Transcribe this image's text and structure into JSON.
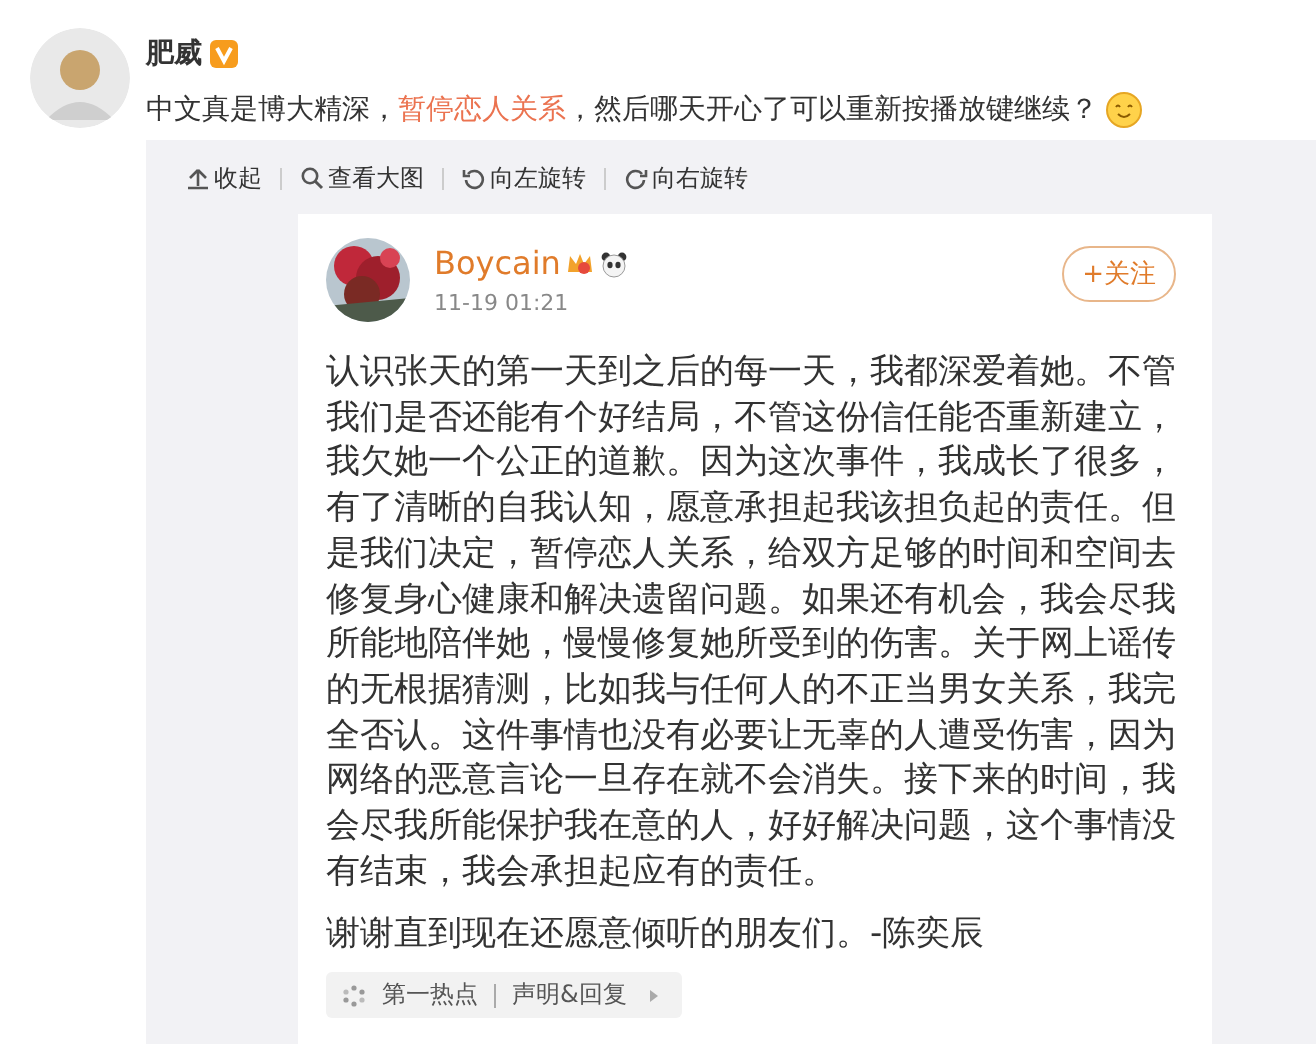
{
  "post": {
    "author": "肥威",
    "verified": true,
    "text_parts": [
      {
        "text": "中文真是博大精深，",
        "highlight": false
      },
      {
        "text": "暂停恋人关系",
        "highlight": true
      },
      {
        "text": "，然后哪天开心了可以重新按播放键继续？",
        "highlight": false
      }
    ]
  },
  "toolbar": [
    "收起",
    "查看大图",
    "向左旋转",
    "向右旋转"
  ],
  "screenshot": {
    "author": "Boycain",
    "time": "11-19 01:21",
    "follow_button": "+关注",
    "body": "认识张天的第一天到之后的每一天，我都深爱着她。不管我们是否还能有个好结局，不管这份信任能否重新建立，我欠她一个公正的道歉。因为这次事件，我成长了很多，有了清晰的自我认知，愿意承担起我该担负起的责任。但是我们决定，暂停恋人关系，给双方足够的时间和空间去修复身心健康和解决遗留问题。如果还有机会，我会尽我所能地陪伴她，慢慢修复她所受到的伤害。关于网上谣传的无根据猜测，比如我与任何人的不正当男女关系，我完全否认。这件事情也没有必要让无辜的人遭受伤害，因为网络的恶意言论一旦存在就不会消失。接下来的时间，我会尽我所能保护我在意的人，好好解决问题，这个事情没有结束，我会承担起应有的责任。",
    "signature": "谢谢直到现在还愿意倾听的朋友们。-陈奕辰",
    "topic_chip": [
      "第一热点",
      "声明&回复"
    ]
  }
}
